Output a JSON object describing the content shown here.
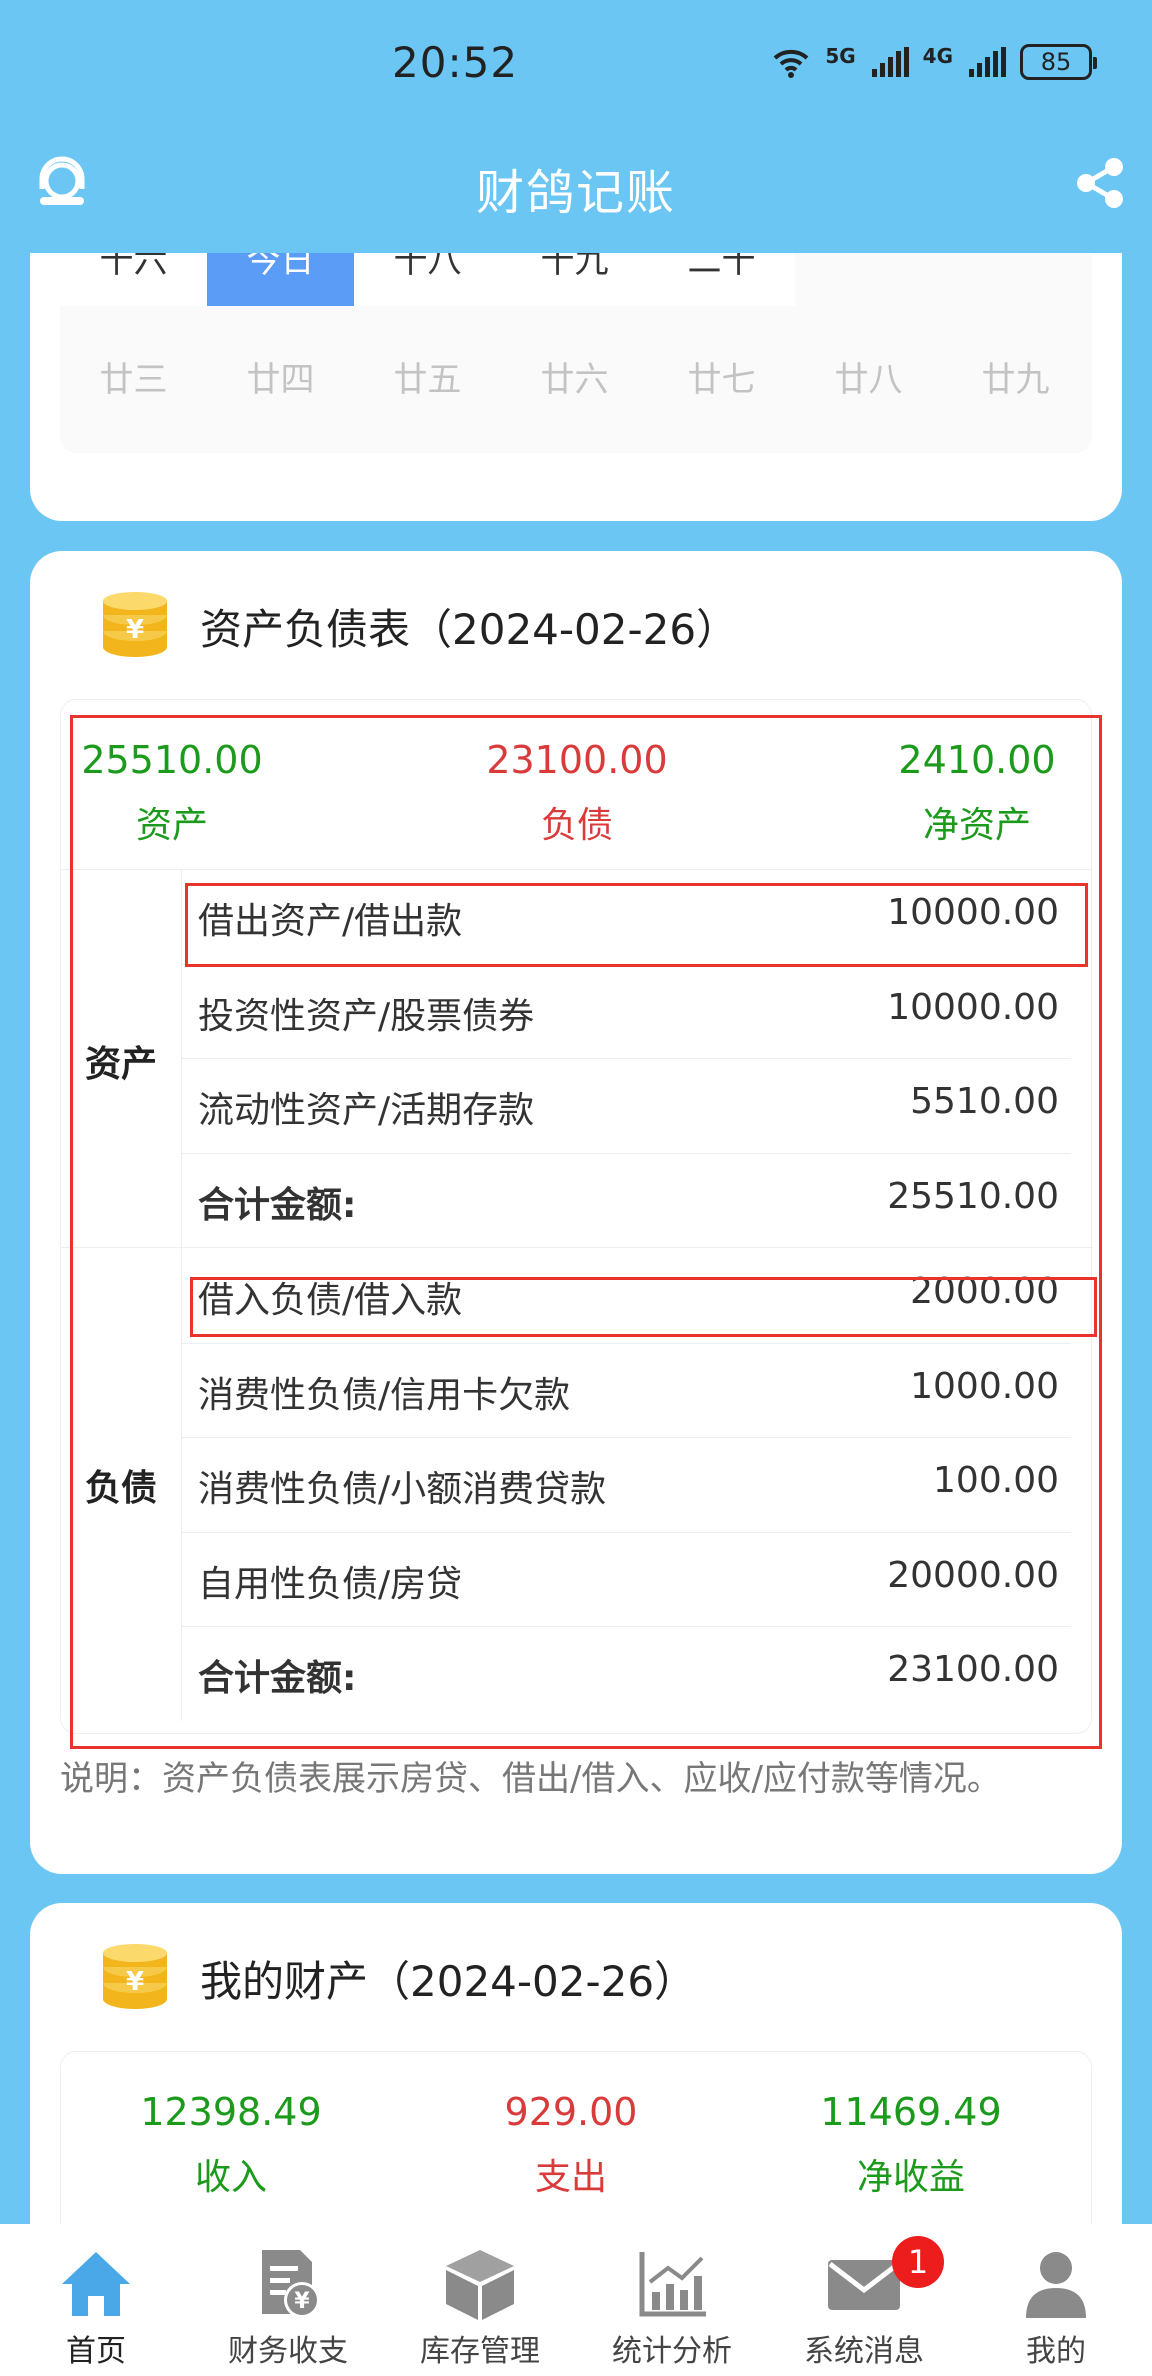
{
  "status_bar": {
    "time": "20:52",
    "network_1": "5G",
    "network_2": "4G",
    "battery": "85"
  },
  "header": {
    "title": "财鸽记账",
    "left_icon": "user-support-icon",
    "right_icon": "share-icon"
  },
  "calendar": {
    "top_row": [
      "十六",
      "今日",
      "十八",
      "十九",
      "二十"
    ],
    "selected_index": 1,
    "bottom_row": [
      "廿三",
      "廿四",
      "廿五",
      "廿六",
      "廿七",
      "廿八",
      "廿九"
    ]
  },
  "balance_sheet": {
    "title": "资产负债表（2024-02-26）",
    "summary": [
      {
        "value": "25510.00",
        "label": "资产",
        "color": "#1b9a1b"
      },
      {
        "value": "23100.00",
        "label": "负债",
        "color": "#d93b3b"
      },
      {
        "value": "2410.00",
        "label": "净资产",
        "color": "#1b9a1b"
      }
    ],
    "assets": {
      "label": "资产",
      "rows": [
        {
          "name": "借出资产/借出款",
          "amount": "10000.00"
        },
        {
          "name": "投资性资产/股票债券",
          "amount": "10000.00"
        },
        {
          "name": "流动性资产/活期存款",
          "amount": "5510.00"
        }
      ],
      "total_label": "合计金额:",
      "total": "25510.00"
    },
    "liabilities": {
      "label": "负债",
      "rows": [
        {
          "name": "借入负债/借入款",
          "amount": "2000.00"
        },
        {
          "name": "消费性负债/信用卡欠款",
          "amount": "1000.00"
        },
        {
          "name": "消费性负债/小额消费贷款",
          "amount": "100.00"
        },
        {
          "name": "自用性负债/房贷",
          "amount": "20000.00"
        }
      ],
      "total_label": "合计金额:",
      "total": "23100.00"
    },
    "note": "说明：资产负债表展示房贷、借出/借入、应收/应付款等情况。"
  },
  "my_assets": {
    "title": "我的财产（2024-02-26）",
    "summary": [
      {
        "value": "12398.49",
        "label": "收入",
        "color": "#1b9a1b"
      },
      {
        "value": "929.00",
        "label": "支出",
        "color": "#d93b3b"
      },
      {
        "value": "11469.49",
        "label": "净收益",
        "color": "#1b9a1b"
      }
    ]
  },
  "bottom_nav": {
    "items": [
      {
        "label": "首页",
        "icon": "home-icon",
        "active": true
      },
      {
        "label": "财务收支",
        "icon": "finance-document-icon"
      },
      {
        "label": "库存管理",
        "icon": "inventory-box-icon"
      },
      {
        "label": "统计分析",
        "icon": "statistics-chart-icon"
      },
      {
        "label": "系统消息",
        "icon": "mail-icon",
        "badge": "1"
      },
      {
        "label": "我的",
        "icon": "profile-icon"
      }
    ]
  },
  "colors": {
    "primary": "#6bc6f4",
    "selected": "#5b9cf7",
    "highlight_border": "#e8352b",
    "positive": "#1b9a1b",
    "negative": "#d93b3b"
  }
}
